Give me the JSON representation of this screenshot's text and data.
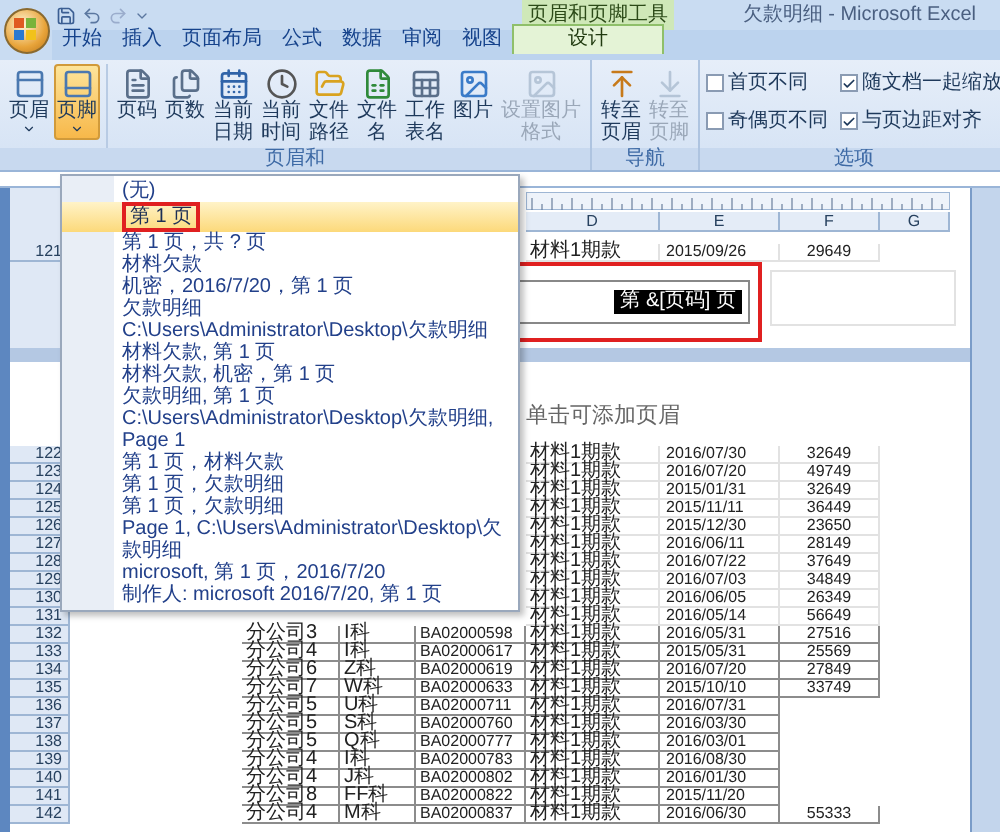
{
  "window": {
    "title": "欠款明细 - Microsoft Excel",
    "tool_context": "页眉和页脚工具"
  },
  "tabs": [
    {
      "label": "开始",
      "selected": false,
      "kind": "standard"
    },
    {
      "label": "插入",
      "selected": false,
      "kind": "standard"
    },
    {
      "label": "页面布局",
      "selected": false,
      "kind": "standard"
    },
    {
      "label": "公式",
      "selected": false,
      "kind": "standard"
    },
    {
      "label": "数据",
      "selected": false,
      "kind": "standard"
    },
    {
      "label": "审阅",
      "selected": false,
      "kind": "standard"
    },
    {
      "label": "视图",
      "selected": false,
      "kind": "standard"
    },
    {
      "label": "设计",
      "selected": true,
      "kind": "contextual"
    }
  ],
  "ribbon": {
    "groups": [
      {
        "label": "页眉和",
        "buttons": [
          {
            "label": "页眉",
            "kind": "dropdown",
            "selected": false,
            "disabled": false
          },
          {
            "label": "页脚",
            "kind": "dropdown",
            "selected": true,
            "disabled": false
          },
          {
            "label": "页码",
            "kind": "button",
            "selected": false,
            "disabled": false
          },
          {
            "label": "页数",
            "kind": "button",
            "selected": false,
            "disabled": false
          },
          {
            "label": "当前日期",
            "kind": "button",
            "selected": false,
            "disabled": false
          },
          {
            "label": "当前时间",
            "kind": "button",
            "selected": false,
            "disabled": false
          },
          {
            "label": "文件路径",
            "kind": "button",
            "selected": false,
            "disabled": false
          },
          {
            "label": "文件名",
            "kind": "button",
            "selected": false,
            "disabled": false
          },
          {
            "label": "工作表名",
            "kind": "button",
            "selected": false,
            "disabled": false
          },
          {
            "label": "图片",
            "kind": "button",
            "selected": false,
            "disabled": false
          },
          {
            "label": "设置图片格式",
            "kind": "button",
            "selected": false,
            "disabled": true
          }
        ]
      },
      {
        "label": "导航",
        "buttons": [
          {
            "label": "转至页眉",
            "kind": "button",
            "selected": false,
            "disabled": false
          },
          {
            "label": "转至页脚",
            "kind": "button",
            "selected": false,
            "disabled": true
          }
        ]
      },
      {
        "label": "选项",
        "options": [
          {
            "label": "首页不同",
            "checked": false
          },
          {
            "label": "随文档一起缩放",
            "checked": true
          },
          {
            "label": "奇偶页不同",
            "checked": false
          },
          {
            "label": "与页边距对齐",
            "checked": true
          }
        ]
      }
    ]
  },
  "menu": {
    "items": [
      {
        "label": "(无)",
        "selected": false
      },
      {
        "label": "第 1 页",
        "selected": true
      },
      {
        "label": "第 1 页，共 ? 页",
        "selected": false
      },
      {
        "label": "材料欠款",
        "selected": false
      },
      {
        "label": "机密，2016/7/20，第 1 页",
        "selected": false
      },
      {
        "label": "欠款明细",
        "selected": false
      },
      {
        "label": "C:\\Users\\Administrator\\Desktop\\欠款明细",
        "selected": false
      },
      {
        "label": "材料欠款, 第 1 页",
        "selected": false
      },
      {
        "label": "材料欠款, 机密，第 1 页",
        "selected": false
      },
      {
        "label": "欠款明细, 第 1 页",
        "selected": false
      },
      {
        "label": "C:\\Users\\Administrator\\Desktop\\欠款明细, Page 1",
        "selected": false
      },
      {
        "label": "第 1 页，材料欠款",
        "selected": false
      },
      {
        "label": "第 1 页，欠款明细",
        "selected": false
      },
      {
        "label": "第 1 页，欠款明细",
        "selected": false
      },
      {
        "label": "Page 1, C:\\Users\\Administrator\\Desktop\\欠款明细",
        "selected": false
      },
      {
        "label": "microsoft, 第 1 页，2016/7/20",
        "selected": false
      },
      {
        "label": "制作人: microsoft 2016/7/20, 第 1 页",
        "selected": false
      }
    ]
  },
  "sheet": {
    "column_headers": [
      "D",
      "E",
      "F",
      "G"
    ],
    "header_editor": {
      "text": "第 &[页码] 页",
      "selected": true
    },
    "header_hint": "单击可添加页眉",
    "top_rows": [
      {
        "number": "121",
        "cells": [
          null,
          null,
          null,
          "材料1期款",
          "2015/09/26",
          "29649"
        ]
      }
    ],
    "rows": [
      {
        "number": "122",
        "cells": [
          null,
          null,
          null,
          "材料1期款",
          "2016/07/30",
          "32649"
        ]
      },
      {
        "number": "123",
        "cells": [
          null,
          null,
          null,
          "材料1期款",
          "2016/07/20",
          "49749"
        ]
      },
      {
        "number": "124",
        "cells": [
          null,
          null,
          null,
          "材料1期款",
          "2015/01/31",
          "32649"
        ]
      },
      {
        "number": "125",
        "cells": [
          null,
          null,
          null,
          "材料1期款",
          "2015/11/11",
          "36449"
        ]
      },
      {
        "number": "126",
        "cells": [
          null,
          null,
          null,
          "材料1期款",
          "2015/12/30",
          "23650"
        ]
      },
      {
        "number": "127",
        "cells": [
          null,
          null,
          null,
          "材料1期款",
          "2016/06/11",
          "28149"
        ]
      },
      {
        "number": "128",
        "cells": [
          null,
          null,
          null,
          "材料1期款",
          "2016/07/22",
          "37649"
        ]
      },
      {
        "number": "129",
        "cells": [
          null,
          null,
          null,
          "材料1期款",
          "2016/07/03",
          "34849"
        ]
      },
      {
        "number": "130",
        "cells": [
          null,
          null,
          null,
          "材料1期款",
          "2016/06/05",
          "26349"
        ]
      },
      {
        "number": "131",
        "cells": [
          null,
          null,
          null,
          "材料1期款",
          "2016/05/14",
          "56649"
        ]
      },
      {
        "number": "132",
        "cells": [
          "分公司3",
          "I科",
          "BA02000598",
          "材料1期款",
          "2016/05/31",
          "27516"
        ]
      },
      {
        "number": "133",
        "cells": [
          "分公司4",
          "I科",
          "BA02000617",
          "材料1期款",
          "2015/05/31",
          "25569"
        ]
      },
      {
        "number": "134",
        "cells": [
          "分公司6",
          "Z科",
          "BA02000619",
          "材料1期款",
          "2016/07/20",
          "27849"
        ]
      },
      {
        "number": "135",
        "cells": [
          "分公司7",
          "W科",
          "BA02000633",
          "材料1期款",
          "2015/10/10",
          "33749"
        ]
      },
      {
        "number": "136",
        "cells": [
          "分公司5",
          "U科",
          "BA02000711",
          "材料1期款",
          "2016/07/31",
          null
        ]
      },
      {
        "number": "137",
        "cells": [
          "分公司5",
          "S科",
          "BA02000760",
          "材料1期款",
          "2016/03/30",
          null
        ]
      },
      {
        "number": "138",
        "cells": [
          "分公司5",
          "Q科",
          "BA02000777",
          "材料1期款",
          "2016/03/01",
          null
        ]
      },
      {
        "number": "139",
        "cells": [
          "分公司4",
          "I科",
          "BA02000783",
          "材料1期款",
          "2016/08/30",
          null
        ]
      },
      {
        "number": "140",
        "cells": [
          "分公司4",
          "J科",
          "BA02000802",
          "材料1期款",
          "2016/01/30",
          null
        ]
      },
      {
        "number": "141",
        "cells": [
          "分公司8",
          "FF科",
          "BA02000822",
          "材料1期款",
          "2015/11/20",
          null
        ]
      },
      {
        "number": "142",
        "cells": [
          "分公司4",
          "M科",
          "BA02000837",
          "材料1期款",
          "2016/06/30",
          "55333"
        ]
      }
    ]
  }
}
